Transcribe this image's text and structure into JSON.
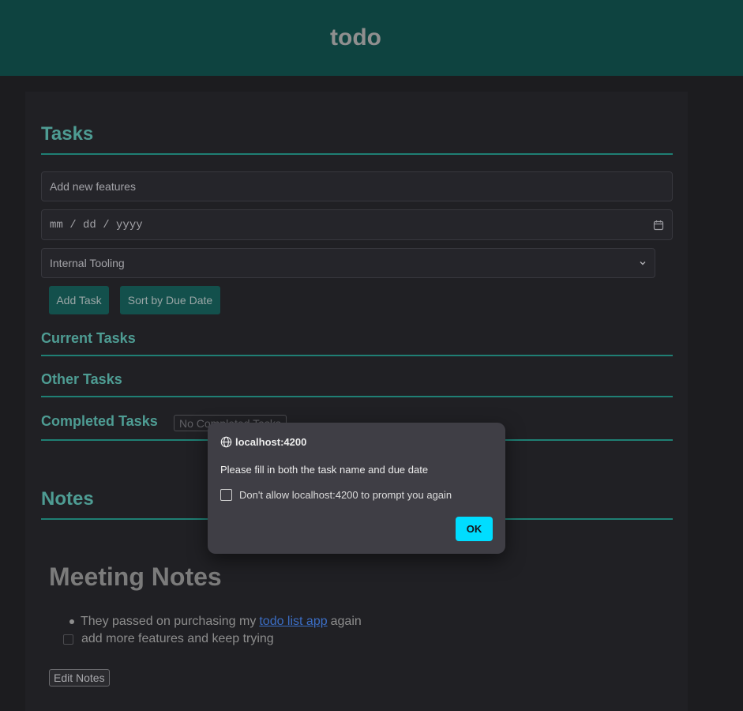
{
  "app": {
    "title": "todo"
  },
  "tasks": {
    "heading": "Tasks",
    "name_input_value": "Add new features",
    "date_placeholder": "mm / dd / yyyy",
    "category_selected": "Internal Tooling",
    "add_button": "Add Task",
    "sort_button": "Sort by Due Date",
    "current_heading": "Current Tasks",
    "other_heading": "Other Tasks",
    "completed_heading": "Completed Tasks",
    "completed_empty": "No Completed Tasks"
  },
  "notes": {
    "heading": "Notes",
    "title": "Meeting Notes",
    "bullet_prefix": "They passed on purchasing my",
    "bullet_link": "todo list app",
    "bullet_suffix": "again",
    "check_item": "add more features and keep trying",
    "edit_button": "Edit Notes"
  },
  "dialog": {
    "origin": "localhost:4200",
    "message": "Please fill in both the task name and due date",
    "checkbox_label": "Don't allow localhost:4200 to prompt you again",
    "ok_button": "OK",
    "icons": {
      "origin": "globe-icon"
    }
  },
  "colors": {
    "header_bg": "#0e4340",
    "accent": "#4e9c93",
    "dialog_ok": "#00ddff"
  }
}
